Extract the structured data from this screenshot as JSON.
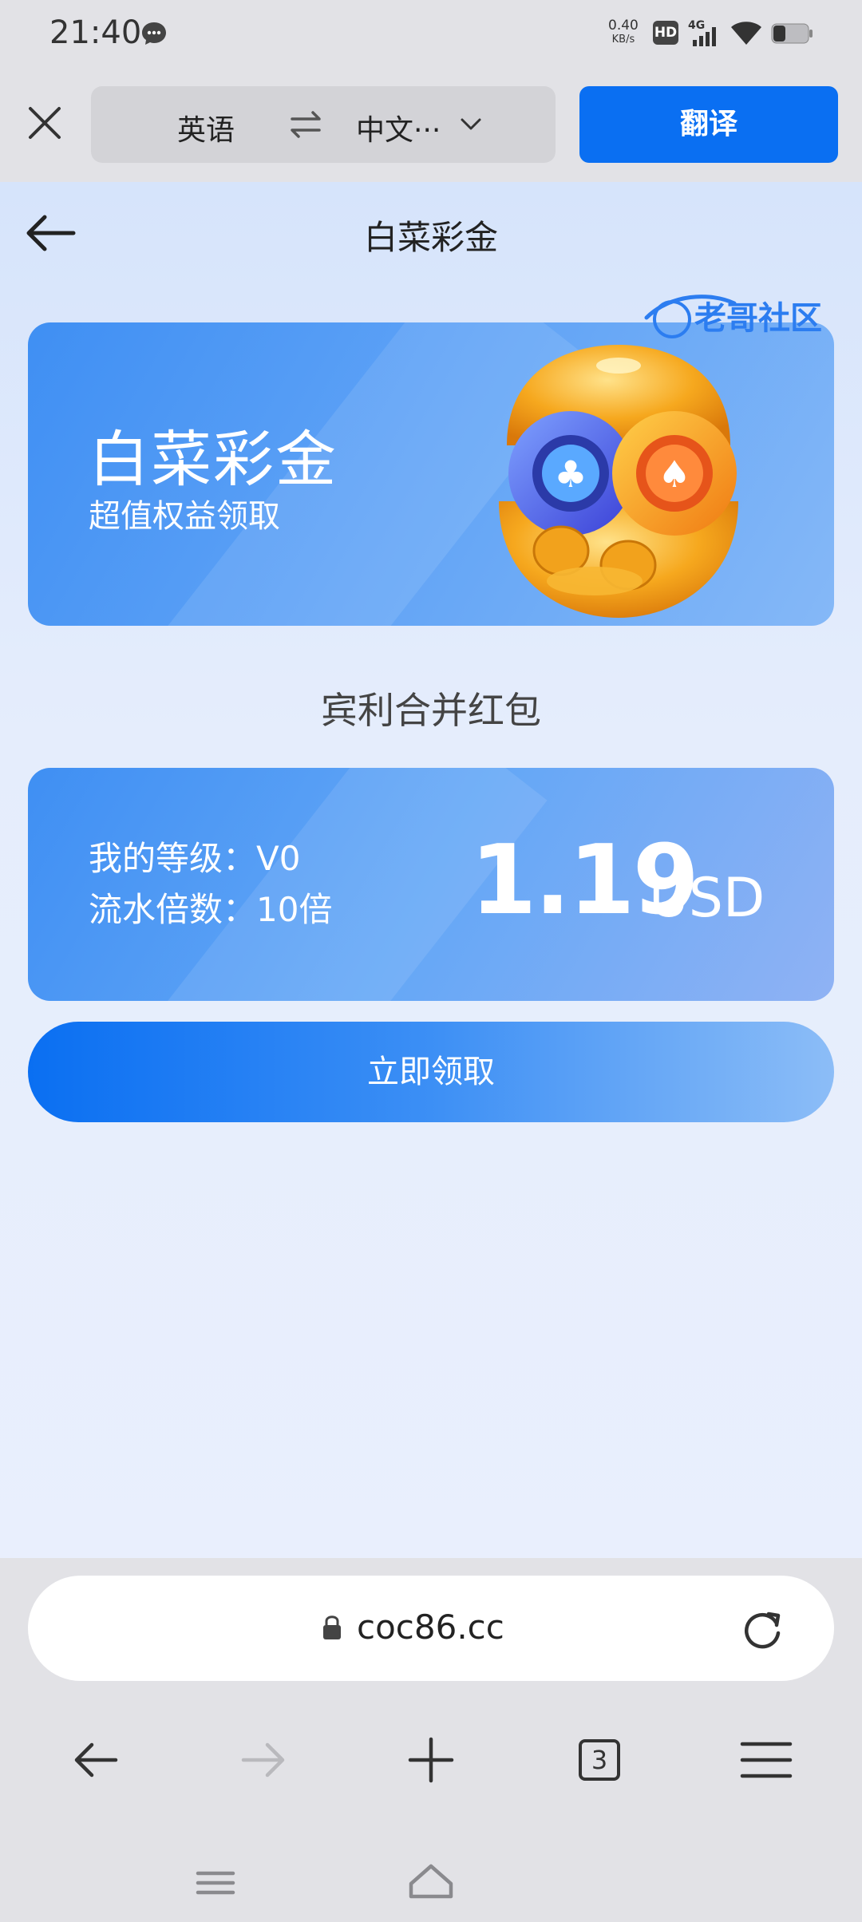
{
  "status_bar": {
    "time": "21:40",
    "net_speed_value": "0.40",
    "net_speed_unit": "KB/s",
    "hd_label": "HD",
    "network_label": "4G",
    "icons": [
      "message-icon",
      "hd-icon",
      "signal-icon",
      "wifi-icon",
      "battery-icon"
    ]
  },
  "translate_bar": {
    "source_lang": "英语",
    "target_lang": "中文···",
    "translate_label": "翻译"
  },
  "page": {
    "title": "白菜彩金",
    "banner": {
      "title": "白菜彩金",
      "subtitle": "超值权益领取"
    },
    "section_title": "宾利合并红包",
    "info": {
      "level_label": "我的等级：",
      "level_value": "V0",
      "wager_label": "流水倍数：",
      "wager_value": "10倍",
      "amount": "1.19",
      "currency": "USD"
    },
    "claim_label": "立即领取",
    "colors": {
      "accent": "#0a6ff2",
      "card": "#4f97f4"
    }
  },
  "browser": {
    "url": "coc86.cc",
    "tab_count": "3",
    "watermark": "老哥社区"
  }
}
